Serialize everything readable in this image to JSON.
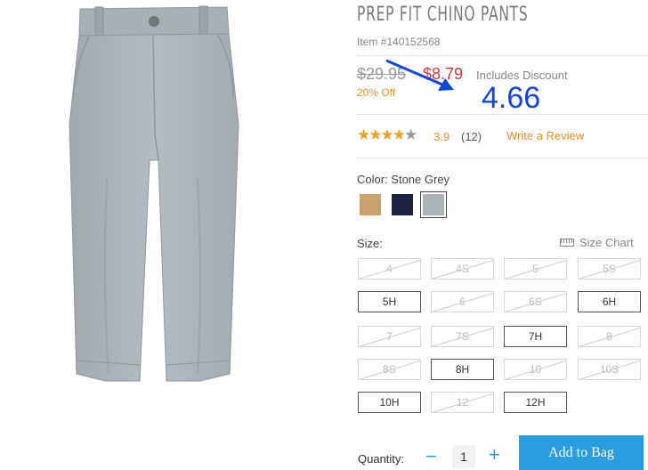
{
  "product": {
    "title": "PREP FIT CHINO PANTS",
    "item_number": "Item #140152568",
    "original_price": "$29.95",
    "sale_price": "$8.79",
    "discount_note": "Includes Discount",
    "percent_off": "20% Off",
    "rating": "3.9",
    "review_count": "(12)",
    "write_review": "Write a Review",
    "stars_filled": 4,
    "color_label": "Color: Stone Grey",
    "colors": [
      "#c9a26d",
      "#1b2340",
      "#aab3b8"
    ],
    "selected_color": "Stone Grey"
  },
  "annotation": {
    "text": "4.66",
    "color": "#1346e0"
  },
  "sizes": {
    "label": "Size:",
    "chart_link": "Size Chart",
    "options": [
      {
        "label": "4",
        "available": false
      },
      {
        "label": "4S",
        "available": false
      },
      {
        "label": "5",
        "available": false
      },
      {
        "label": "5S",
        "available": false
      },
      {
        "label": "5H",
        "available": true
      },
      {
        "label": "6",
        "available": false
      },
      {
        "label": "6S",
        "available": false
      },
      {
        "label": "6H",
        "available": true
      },
      {
        "label": "7",
        "available": false
      },
      {
        "label": "7S",
        "available": false
      },
      {
        "label": "7H",
        "available": true
      },
      {
        "label": "8",
        "available": false
      },
      {
        "label": "8S",
        "available": false
      },
      {
        "label": "8H",
        "available": true
      },
      {
        "label": "10",
        "available": false
      },
      {
        "label": "10S",
        "available": false
      },
      {
        "label": "10H",
        "available": true
      },
      {
        "label": "12",
        "available": false
      },
      {
        "label": "12H",
        "available": true
      }
    ]
  },
  "purchase": {
    "quantity_label": "Quantity:",
    "quantity": "1",
    "minus": "−",
    "plus": "+",
    "add_to_bag": "Add to Bag"
  },
  "colors": {
    "accent": "#2a9de0",
    "sale": "#d4363b",
    "highlight": "#f08d2a"
  }
}
